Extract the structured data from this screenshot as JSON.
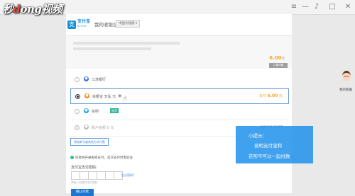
{
  "browser": {
    "watermark": {
      "pre": "秒",
      "mid": "d",
      "post": "ong视频"
    },
    "icons": [
      "menu-icon",
      "minimize-icon",
      "bell-icon",
      "window-icon",
      "close-icon"
    ]
  },
  "header": {
    "logo_glyph": "支",
    "logo_text": "支付宝",
    "logo_sub": "ALIPAY",
    "title": "我的收银台",
    "region": "中国大陆版"
  },
  "summary": {
    "amount": "6.00",
    "unit": "元",
    "detail_button": "订单详情"
  },
  "payment_methods": [
    {
      "name": "method-bank",
      "label": "江苏银行",
      "icon": "bank-icon",
      "icon_glyph": "●",
      "icon_color": "#2f6fd3",
      "selected": false,
      "disabled": false
    },
    {
      "name": "method-balance",
      "label": "余额宝 天弘 元",
      "icon": "yuebao-icon",
      "icon_glyph": "●",
      "icon_color": "#f58b1f",
      "selected": true,
      "disabled": false,
      "pay_label": "支付",
      "pay_amount": "6.00",
      "pay_unit": "元"
    },
    {
      "name": "method-huabei",
      "label": "花呗",
      "icon": "huabei-icon",
      "icon_glyph": "●",
      "icon_color": "#1fa2e6",
      "selected": false,
      "disabled": false,
      "badge": "推荐"
    },
    {
      "name": "method-disabled",
      "label": "账户余额 0 元",
      "icon": "balance-icon",
      "icon_glyph": "●",
      "icon_color": "#bbbbbb",
      "selected": false,
      "disabled": true,
      "right_note": "余额不足 不可用"
    }
  ],
  "other_button": "添加新卡或其他方式付款",
  "agreement": {
    "check": "✓",
    "text": "同意并开通免密支付，首次支付时需验证"
  },
  "password": {
    "label": "支付宝支付密码:",
    "forgot": "忘记密码?",
    "hint": "请输入6位数字支付密码"
  },
  "confirm_button": "确认付款",
  "tip": {
    "title": "小提示：",
    "line1": "说明支付宝和",
    "line2": "花呗不可以一起付款"
  },
  "assistant": {
    "label": "我的客服"
  }
}
